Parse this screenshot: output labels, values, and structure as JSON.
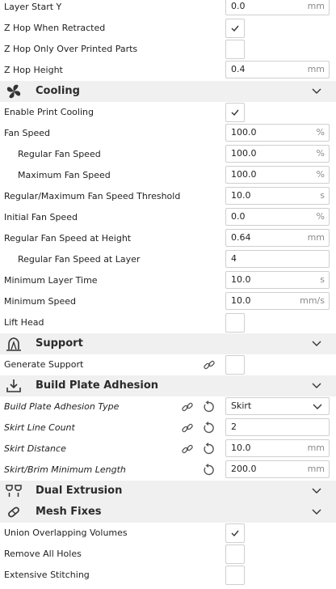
{
  "top": {
    "layer_start_y": {
      "label": "Layer Start Y",
      "value": "0.0",
      "unit": "mm"
    },
    "z_hop_when_retracted": {
      "label": "Z Hop When Retracted",
      "checked": true
    },
    "z_hop_only_over_printed": {
      "label": "Z Hop Only Over Printed Parts",
      "checked": false
    },
    "z_hop_height": {
      "label": "Z Hop Height",
      "value": "0.4",
      "unit": "mm"
    }
  },
  "cooling": {
    "title": "Cooling",
    "enable_print_cooling": {
      "label": "Enable Print Cooling",
      "checked": true
    },
    "fan_speed": {
      "label": "Fan Speed",
      "value": "100.0",
      "unit": "%"
    },
    "regular_fan_speed": {
      "label": "Regular Fan Speed",
      "value": "100.0",
      "unit": "%"
    },
    "maximum_fan_speed": {
      "label": "Maximum Fan Speed",
      "value": "100.0",
      "unit": "%"
    },
    "threshold": {
      "label": "Regular/Maximum Fan Speed Threshold",
      "value": "10.0",
      "unit": "s"
    },
    "initial_fan_speed": {
      "label": "Initial Fan Speed",
      "value": "0.0",
      "unit": "%"
    },
    "fan_speed_at_height": {
      "label": "Regular Fan Speed at Height",
      "value": "0.64",
      "unit": "mm"
    },
    "fan_speed_at_layer": {
      "label": "Regular Fan Speed at Layer",
      "value": "4",
      "unit": ""
    },
    "minimum_layer_time": {
      "label": "Minimum Layer Time",
      "value": "10.0",
      "unit": "s"
    },
    "minimum_speed": {
      "label": "Minimum Speed",
      "value": "10.0",
      "unit": "mm/s"
    },
    "lift_head": {
      "label": "Lift Head",
      "checked": false
    }
  },
  "support": {
    "title": "Support",
    "generate_support": {
      "label": "Generate Support",
      "checked": false
    }
  },
  "adhesion": {
    "title": "Build Plate Adhesion",
    "type": {
      "label": "Build Plate Adhesion Type",
      "value": "Skirt"
    },
    "skirt_line_count": {
      "label": "Skirt Line Count",
      "value": "2",
      "unit": ""
    },
    "skirt_distance": {
      "label": "Skirt Distance",
      "value": "10.0",
      "unit": "mm"
    },
    "skirt_min_length": {
      "label": "Skirt/Brim Minimum Length",
      "value": "200.0",
      "unit": "mm"
    }
  },
  "dual": {
    "title": "Dual Extrusion"
  },
  "mesh": {
    "title": "Mesh Fixes",
    "union_overlapping": {
      "label": "Union Overlapping Volumes",
      "checked": true
    },
    "remove_all_holes": {
      "label": "Remove All Holes",
      "checked": false
    },
    "extensive_stitching": {
      "label": "Extensive Stitching",
      "checked": false
    }
  },
  "icons": {
    "cooling": "fan-icon",
    "support": "support-icon",
    "adhesion": "build-plate-icon",
    "dual": "dual-extrusion-icon",
    "mesh": "mesh-fix-icon",
    "link": "link-icon",
    "reset": "reset-icon",
    "chevron": "chevron-down-icon",
    "check": "checkmark-icon"
  }
}
